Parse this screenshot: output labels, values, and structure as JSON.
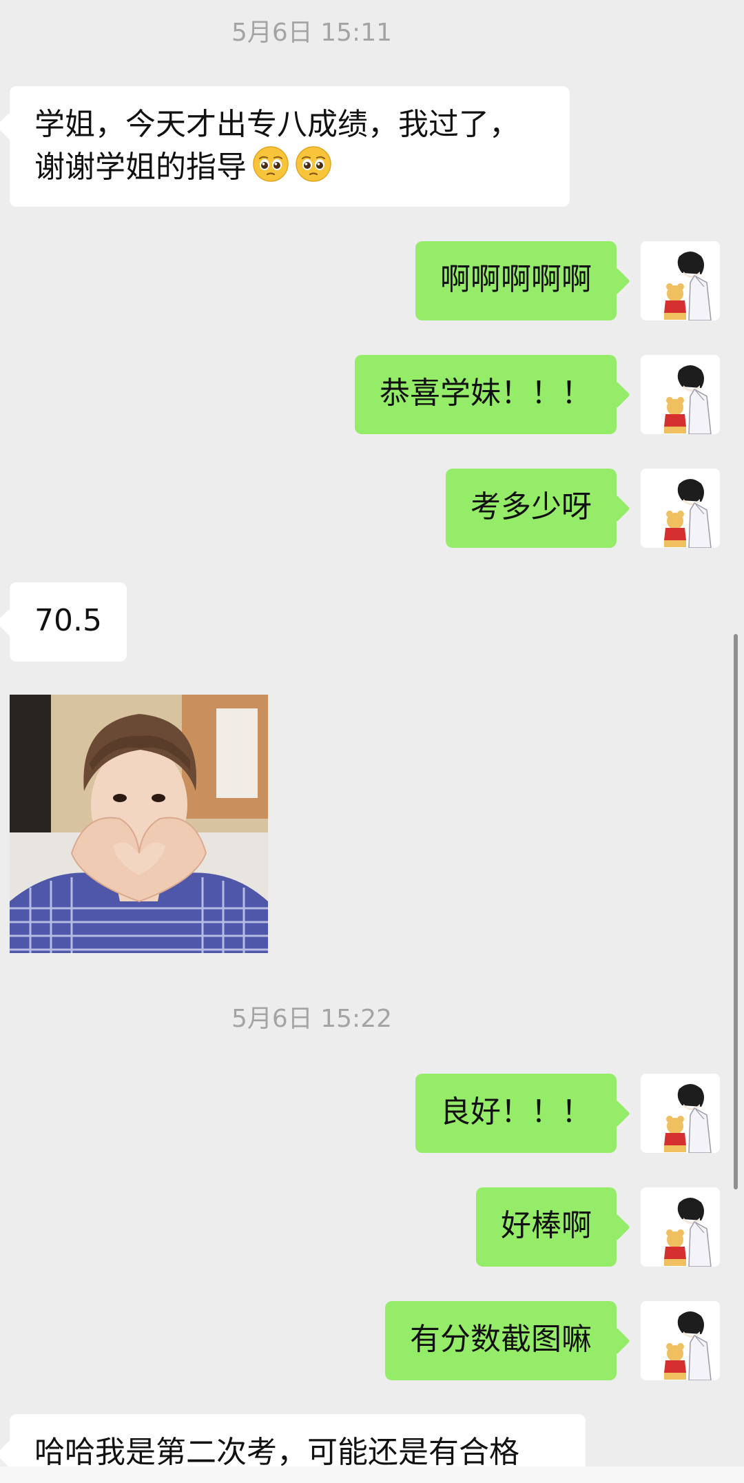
{
  "app": {
    "type": "chat-conversation"
  },
  "timestamps": [
    {
      "text": "5月6日 15:11"
    },
    {
      "text": "5月6日 15:22"
    }
  ],
  "messages": [
    {
      "side": "left",
      "text_line1": "学姐，今天才出专八成绩，我过了，",
      "text_line2": "谢谢学姐的指导",
      "emojis": [
        "pleading-face",
        "pleading-face"
      ]
    },
    {
      "side": "right",
      "text": "啊啊啊啊啊"
    },
    {
      "side": "right",
      "text": "恭喜学妹！！！"
    },
    {
      "side": "right",
      "text": "考多少呀"
    },
    {
      "side": "left",
      "text": "70.5"
    },
    {
      "side": "left",
      "type": "image",
      "description_icon": "photo-heart-hands"
    },
    {
      "side": "right",
      "text": "良好！！！"
    },
    {
      "side": "right",
      "text": "好棒啊"
    },
    {
      "side": "right",
      "text": "有分数截图嘛"
    },
    {
      "side": "left",
      "text": "哈哈我是第二次考，可能还是有合格"
    }
  ],
  "colors": {
    "background": "#ededed",
    "incoming_bubble": "#ffffff",
    "outgoing_bubble": "#95ec69",
    "timestamp_text": "#a4a4a4"
  }
}
